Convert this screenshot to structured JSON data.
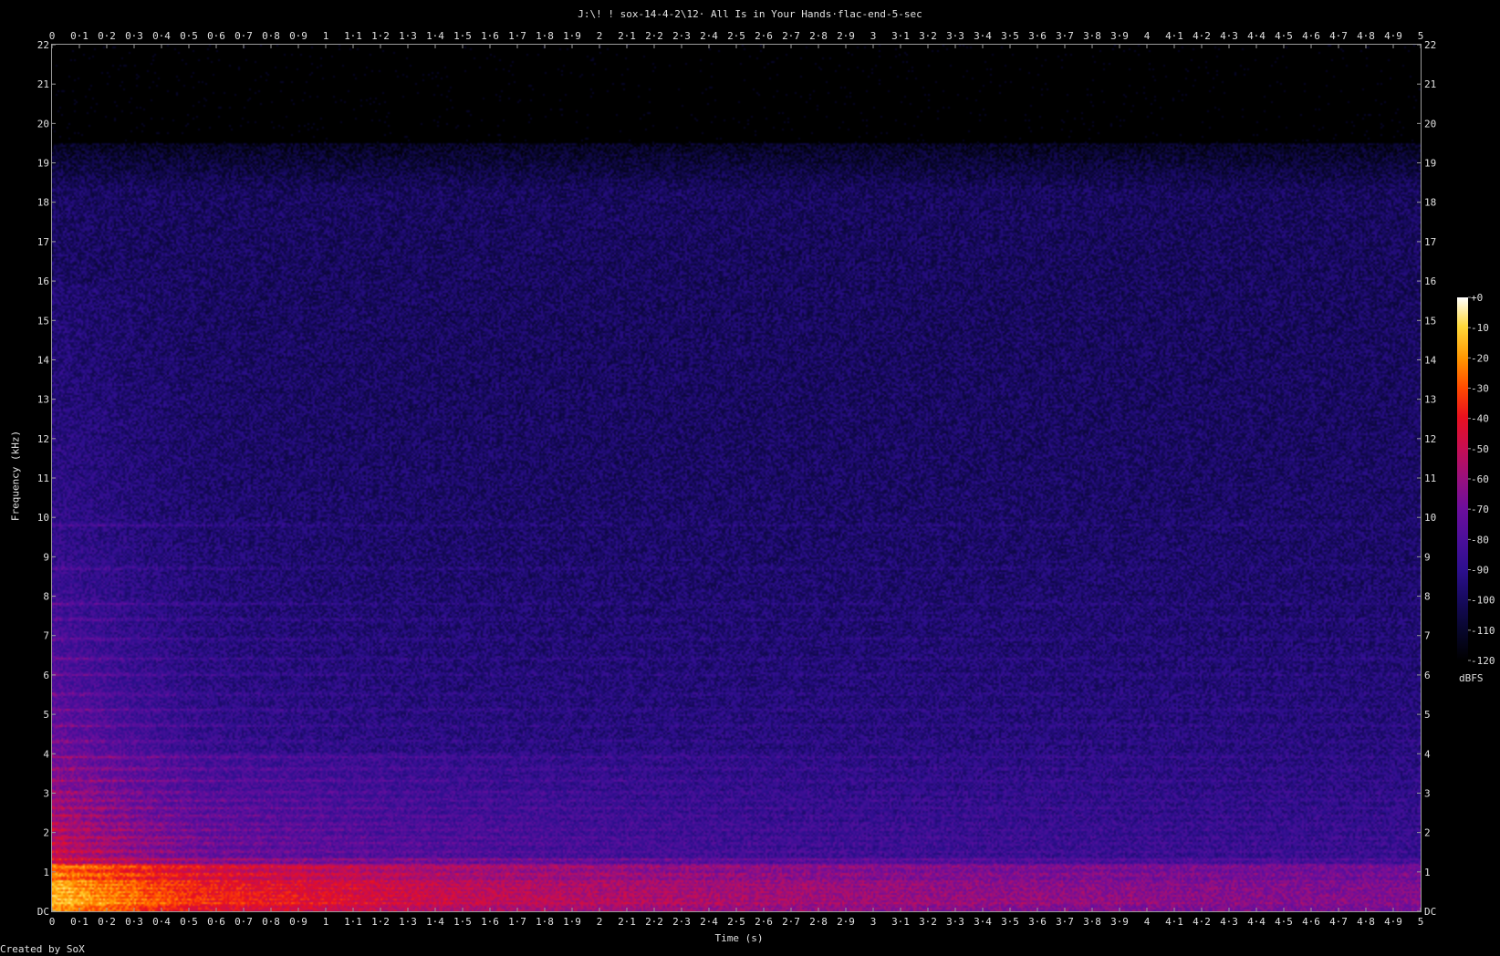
{
  "chart_data": {
    "type": "heatmap",
    "title": "J:\\! ! sox-14-4-2\\12· All Is in Your Hands·flac-end-5-sec",
    "xlabel": "Time (s)",
    "ylabel": "Frequency (kHz)",
    "credit": "Created by SoX",
    "xlim": [
      0,
      5
    ],
    "ylim": [
      0,
      22
    ],
    "x_ticks": [
      "0",
      "0·1",
      "0·2",
      "0·3",
      "0·4",
      "0·5",
      "0·6",
      "0·7",
      "0·8",
      "0·9",
      "1",
      "1·1",
      "1·2",
      "1·3",
      "1·4",
      "1·5",
      "1·6",
      "1·7",
      "1·8",
      "1·9",
      "2",
      "2·1",
      "2·2",
      "2·3",
      "2·4",
      "2·5",
      "2·6",
      "2·7",
      "2·8",
      "2·9",
      "3",
      "3·1",
      "3·2",
      "3·3",
      "3·4",
      "3·5",
      "3·6",
      "3·7",
      "3·8",
      "3·9",
      "4",
      "4·1",
      "4·2",
      "4·3",
      "4·4",
      "4·5",
      "4·6",
      "4·7",
      "4·8",
      "4·9",
      "5"
    ],
    "y_ticks": [
      "DC",
      "1",
      "2",
      "3",
      "4",
      "5",
      "6",
      "7",
      "8",
      "9",
      "10",
      "11",
      "12",
      "13",
      "14",
      "15",
      "16",
      "17",
      "18",
      "19",
      "20",
      "21",
      "22"
    ],
    "colorbar": {
      "label": "dBFS",
      "ticks": [
        "+0",
        "-10",
        "-20",
        "-30",
        "-40",
        "-50",
        "-60",
        "-70",
        "-80",
        "-90",
        "-100",
        "-110",
        "-120"
      ],
      "range": [
        -120,
        0
      ]
    },
    "content_cutoff_khz": 19.5,
    "grid": false
  }
}
